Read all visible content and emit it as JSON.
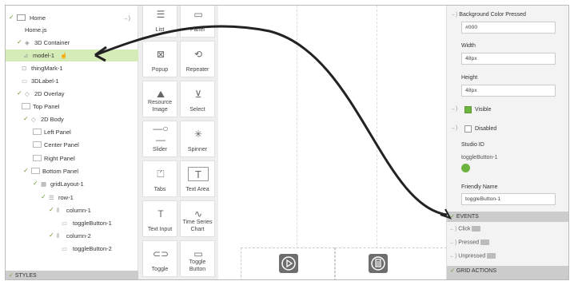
{
  "tree": {
    "items": [
      {
        "label": "Home",
        "level": 0
      },
      {
        "label": "Home.js",
        "level": 0
      },
      {
        "label": "3D Container",
        "level": 1
      },
      {
        "label": "model-1",
        "level": 2
      },
      {
        "label": "thingMark-1",
        "level": 2
      },
      {
        "label": "3DLabel-1",
        "level": 2
      },
      {
        "label": "2D Overlay",
        "level": 1
      },
      {
        "label": "Top Panel",
        "level": 2
      },
      {
        "label": "2D Body",
        "level": 2
      },
      {
        "label": "Left Panel",
        "level": 3
      },
      {
        "label": "Center Panel",
        "level": 3
      },
      {
        "label": "Right Panel",
        "level": 3
      },
      {
        "label": "Bottom Panel",
        "level": 2
      },
      {
        "label": "gridLayout-1",
        "level": 3
      },
      {
        "label": "row-1",
        "level": 4
      },
      {
        "label": "column-1",
        "level": 5
      },
      {
        "label": "toggleButton-1",
        "level": 6
      },
      {
        "label": "column-2",
        "level": 5
      },
      {
        "label": "toggleButton-2",
        "level": 6
      }
    ],
    "styles_label": "STYLES"
  },
  "palette": {
    "widgets": [
      {
        "label": "List",
        "icon": "list-icon"
      },
      {
        "label": "Panel",
        "icon": "panel-icon"
      },
      {
        "label": "Popup",
        "icon": "popup-icon"
      },
      {
        "label": "Repeater",
        "icon": "repeater-icon"
      },
      {
        "label": "Resource Image",
        "icon": "image-icon"
      },
      {
        "label": "Select",
        "icon": "select-icon"
      },
      {
        "label": "Slider",
        "icon": "slider-icon"
      },
      {
        "label": "Spinner",
        "icon": "spinner-icon"
      },
      {
        "label": "Tabs",
        "icon": "tabs-icon"
      },
      {
        "label": "Text Area",
        "icon": "text-area-icon"
      },
      {
        "label": "Text Input",
        "icon": "text-input-icon"
      },
      {
        "label": "Time Series Chart",
        "icon": "chart-icon"
      },
      {
        "label": "Toggle",
        "icon": "toggle-icon"
      },
      {
        "label": "Toggle Button",
        "icon": "toggle-button-icon"
      }
    ]
  },
  "props": {
    "bg_pressed_label": "Background Color Pressed",
    "bg_pressed_value": "#000",
    "width_label": "Width",
    "width_value": "48px",
    "height_label": "Height",
    "height_value": "48px",
    "visible_label": "Visible",
    "disabled_label": "Disabled",
    "studio_id_label": "Studio ID",
    "studio_id_value": "toggleButton-1",
    "friendly_name_label": "Friendly Name",
    "friendly_name_value": "toggleButton-1",
    "events_label": "EVENTS",
    "events": [
      "Click",
      "Pressed",
      "Unpressed"
    ],
    "grid_actions_label": "GRID ACTIONS"
  },
  "colors": {
    "accent": "#6db33f",
    "selected_row": "#d6ecb8",
    "bar": "#cccccc"
  }
}
